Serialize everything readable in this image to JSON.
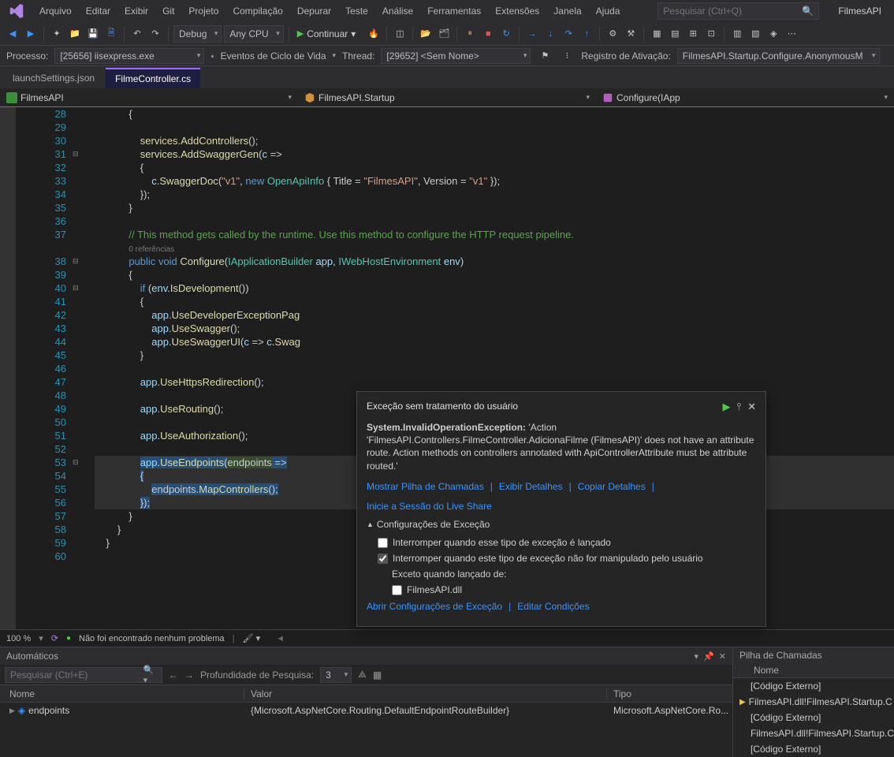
{
  "menu": {
    "items": [
      "Arquivo",
      "Editar",
      "Exibir",
      "Git",
      "Projeto",
      "Compilação",
      "Depurar",
      "Teste",
      "Análise",
      "Ferramentas",
      "Extensões",
      "Janela",
      "Ajuda"
    ]
  },
  "search": {
    "placeholder": "Pesquisar (Ctrl+Q)"
  },
  "projectName": "FilmesAPI",
  "toolbar": {
    "configDebug": "Debug",
    "configCpu": "Any CPU",
    "continuar": "Continuar"
  },
  "debugbar": {
    "processoLabel": "Processo:",
    "processoValue": "[25656] iisexpress.exe",
    "eventos": "Eventos de Ciclo de Vida",
    "threadLabel": "Thread:",
    "threadValue": "[29652] <Sem Nome>",
    "regAtiv": "Registro de Ativação:",
    "regAtivValue": "FilmesAPI.Startup.Configure.AnonymousM"
  },
  "tabs": {
    "inactive": "launchSettings.json",
    "active": "FilmeController.cs"
  },
  "nav": {
    "left": "FilmesAPI",
    "center": "FilmesAPI.Startup",
    "right": "Configure(IApp"
  },
  "code": {
    "lines": [
      {
        "n": 28,
        "t": "            {"
      },
      {
        "n": 29,
        "t": ""
      },
      {
        "n": 30,
        "t": "                <mt>services</mt>.<mt>AddControllers</mt>();"
      },
      {
        "n": 31,
        "t": "                <mt>services</mt>.<mt>AddSwaggerGen</mt>(<pa>c</pa> =>",
        "fold": "⊟"
      },
      {
        "n": 32,
        "t": "                {"
      },
      {
        "n": 33,
        "t": "                    <pa>c</pa>.<mt>SwaggerDoc</mt>(<st>\"v1\"</st>, <kw>new</kw> <ty>OpenApiInfo</ty> { Title = <st>\"FilmesAPI\"</st>, Version = <st>\"v1\"</st> });"
      },
      {
        "n": 34,
        "t": "                });"
      },
      {
        "n": 35,
        "t": "            }"
      },
      {
        "n": 36,
        "t": ""
      },
      {
        "n": 37,
        "t": "            <cm>// This method gets called by the runtime. Use this method to configure the HTTP request pipeline.</cm>"
      },
      {
        "n": "",
        "t": "            <ref>0 referências</ref>"
      },
      {
        "n": 38,
        "t": "            <kw>public</kw> <kw>void</kw> <mt>Configure</mt>(<ty>IApplicationBuilder</ty> <pa>app</pa>, <ty>IWebHostEnvironment</ty> <pa>env</pa>)",
        "fold": "⊟"
      },
      {
        "n": 39,
        "t": "            {"
      },
      {
        "n": 40,
        "t": "                <kw>if</kw> (<pa>env</pa>.<mt>IsDevelopment</mt>())",
        "fold": "⊟"
      },
      {
        "n": 41,
        "t": "                {"
      },
      {
        "n": 42,
        "t": "                    <pa>app</pa>.<mt>UseDeveloperExceptionPag</mt>"
      },
      {
        "n": 43,
        "t": "                    <pa>app</pa>.<mt>UseSwagger</mt>();"
      },
      {
        "n": 44,
        "t": "                    <pa>app</pa>.<mt>UseSwaggerUI</mt>(<pa>c</pa> => <pa>c</pa>.<mt>Swag</mt>"
      },
      {
        "n": 45,
        "t": "                }"
      },
      {
        "n": 46,
        "t": ""
      },
      {
        "n": 47,
        "t": "                <pa>app</pa>.<mt>UseHttpsRedirection</mt>();"
      },
      {
        "n": 48,
        "t": ""
      },
      {
        "n": 49,
        "t": "                <pa>app</pa>.<mt>UseRouting</mt>();"
      },
      {
        "n": 50,
        "t": ""
      },
      {
        "n": 51,
        "t": "                <pa>app</pa>.<mt>UseAuthorization</mt>();"
      },
      {
        "n": 52,
        "t": ""
      },
      {
        "n": 53,
        "t": "                <sel><pa>app</pa>.<mt>UseEndpoints</mt>(</sel><selg>endpoints</selg><sel> =></sel>",
        "fold": "⊟",
        "hl": true
      },
      {
        "n": 54,
        "t": "                <sel>{</sel>",
        "hl": true
      },
      {
        "n": 55,
        "t": "                    <sel>endpoints.<mt>MapControllers</mt>();</sel>",
        "hl": true
      },
      {
        "n": 56,
        "t": "                <sel>});</sel>",
        "hl": true
      },
      {
        "n": 57,
        "t": "            }"
      },
      {
        "n": 58,
        "t": "        }"
      },
      {
        "n": 59,
        "t": "    }",
        "fold": ""
      },
      {
        "n": 60,
        "t": ""
      }
    ]
  },
  "exception": {
    "title": "Exceção sem tratamento do usuário",
    "type": "System.InvalidOperationException:",
    "msg": "'Action 'FilmesAPI.Controllers.FilmeController.AdicionaFilme (FilmesAPI)' does not have an attribute route. Action methods on controllers annotated with ApiControllerAttribute must be attribute routed.'",
    "links": [
      "Mostrar Pilha de Chamadas",
      "Exibir Detalhes",
      "Copiar Detalhes",
      "Inicie a Sessão do Live Share"
    ],
    "settingsHdr": "Configurações de Exceção",
    "cb1": "Interromper quando esse tipo de exceção é lançado",
    "cb2": "Interromper quando este tipo de exceção não for manipulado pelo usuário",
    "except": "Exceto quando lançado de:",
    "dll": "FilmesAPI.dll",
    "open": "Abrir Configurações de Exceção",
    "edit": "Editar Condições"
  },
  "status": {
    "zoom": "100 %",
    "noissues": "Não foi encontrado nenhum problema"
  },
  "autos": {
    "title": "Automáticos",
    "search": "Pesquisar (Ctrl+E)",
    "depth": "Profundidade de Pesquisa:",
    "depthVal": "3",
    "cols": {
      "name": "Nome",
      "value": "Valor",
      "type": "Tipo"
    },
    "row": {
      "name": "endpoints",
      "value": "{Microsoft.AspNetCore.Routing.DefaultEndpointRouteBuilder}",
      "type": "Microsoft.AspNetCore.Ro..."
    }
  },
  "callstack": {
    "title": "Pilha de Chamadas",
    "col": "Nome",
    "rows": [
      "[Código Externo]",
      "FilmesAPI.dll!FilmesAPI.Startup.C",
      "[Código Externo]",
      "FilmesAPI.dll!FilmesAPI.Startup.C",
      "[Código Externo]"
    ]
  }
}
